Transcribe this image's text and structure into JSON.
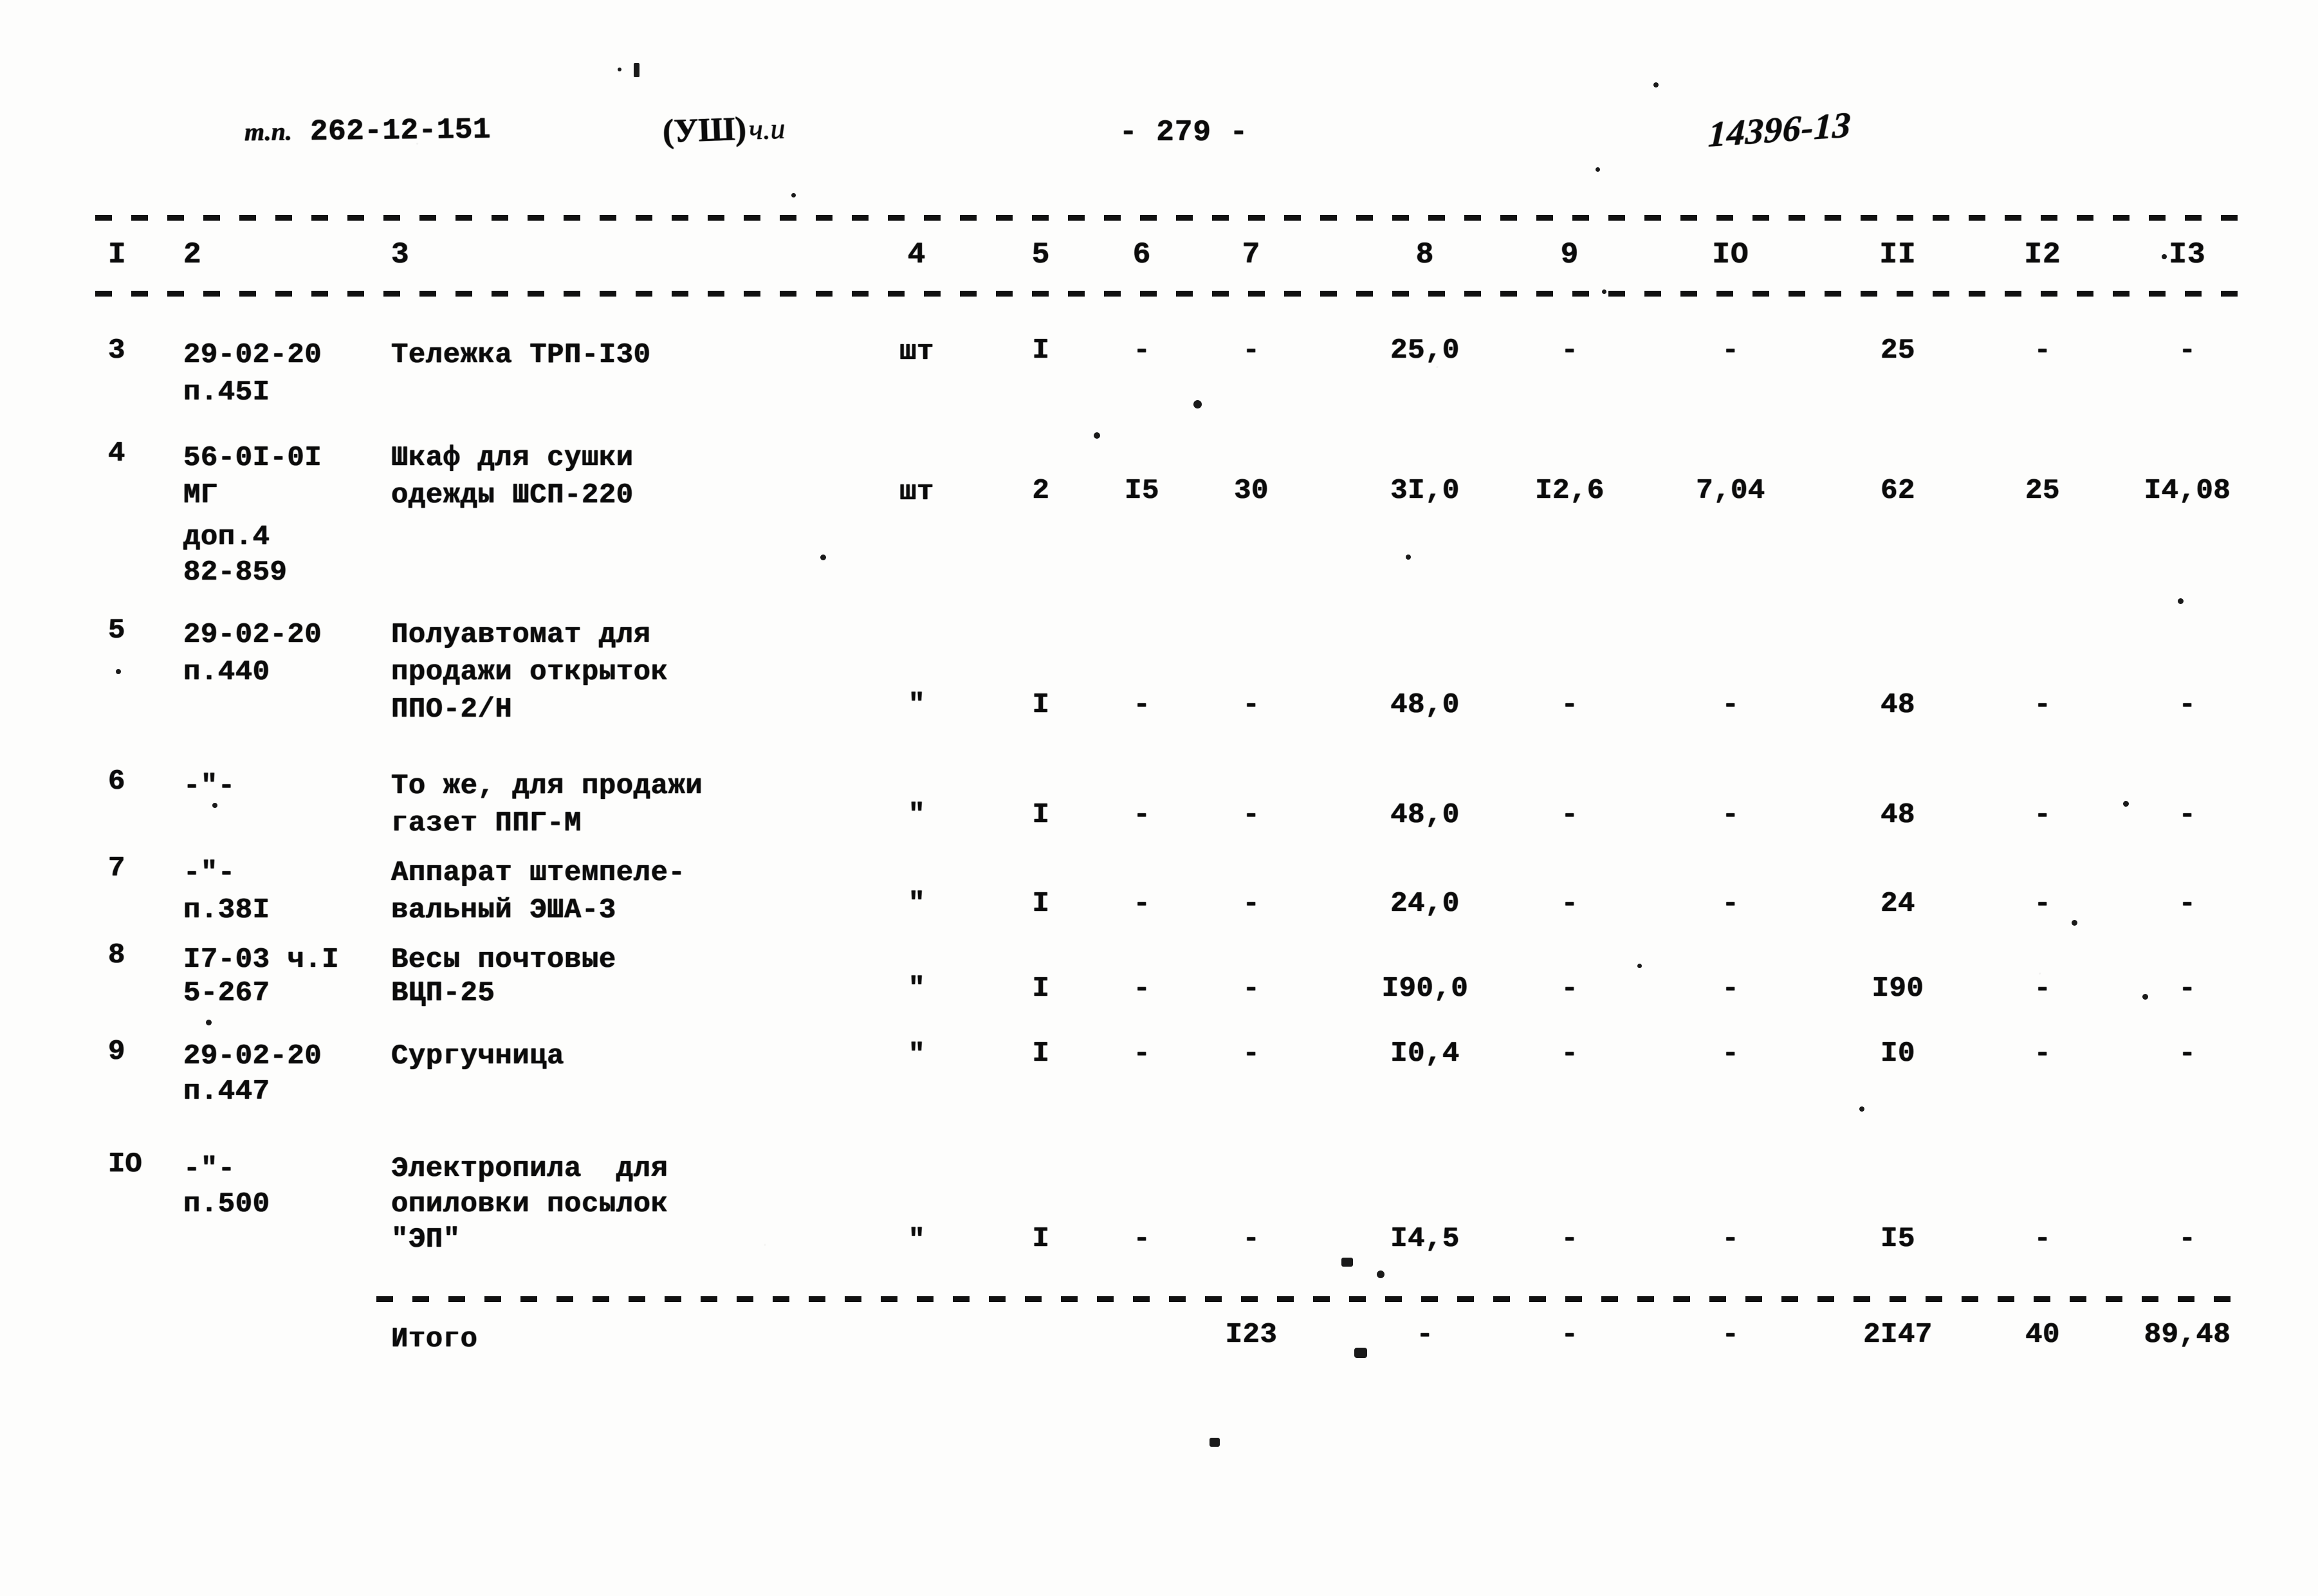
{
  "header": {
    "spec_prefix": "т.п.",
    "spec_code": "262-12-151",
    "hand_note": "(УШ)",
    "hand_scribble": "ч.и",
    "page_number": "- 279 -",
    "hand_archive_number": "14396-13"
  },
  "table": {
    "column_headers": [
      "I",
      "2",
      "3",
      "4",
      "5",
      "6",
      "7",
      "8",
      "9",
      "IO",
      "II",
      "I2",
      "I3"
    ],
    "rows": [
      {
        "index": "3",
        "code_lines": [
          "29-02-20",
          "п.45I"
        ],
        "name_lines": [
          "Тележка ТРП-I30"
        ],
        "c4": "шт",
        "c5": "I",
        "c6": "-",
        "c7": "-",
        "c8": "25,0",
        "c9": "-",
        "c10": "-",
        "c11": "25",
        "c12": "-",
        "c13": "-"
      },
      {
        "index": "4",
        "code_lines": [
          "56-0I-0I",
          "МГ",
          "доп.4",
          "82-859"
        ],
        "name_lines": [
          "Шкаф для сушки",
          "одежды ШСП-220"
        ],
        "c4": "шт",
        "c5": "2",
        "c6": "I5",
        "c7": "30",
        "c8": "3I,0",
        "c9": "I2,6",
        "c10": "7,04",
        "c11": "62",
        "c12": "25",
        "c13": "I4,08"
      },
      {
        "index": "5",
        "code_lines": [
          "29-02-20",
          "п.440"
        ],
        "name_lines": [
          "Полуавтомат для",
          "продажи открыток",
          "ППО-2/Н"
        ],
        "c4": "\"",
        "c5": "I",
        "c6": "-",
        "c7": "-",
        "c8": "48,0",
        "c9": "-",
        "c10": "-",
        "c11": "48",
        "c12": "-",
        "c13": "-"
      },
      {
        "index": "6",
        "code_lines": [
          "-\"-"
        ],
        "name_lines": [
          "То же, для продажи",
          "газет ППГ-М"
        ],
        "c4": "\"",
        "c5": "I",
        "c6": "-",
        "c7": "-",
        "c8": "48,0",
        "c9": "-",
        "c10": "-",
        "c11": "48",
        "c12": "-",
        "c13": "-"
      },
      {
        "index": "7",
        "code_lines": [
          "-\"-",
          "п.38I"
        ],
        "name_lines": [
          "Аппарат штемпеле-",
          "вальный ЭША-3"
        ],
        "c4": "\"",
        "c5": "I",
        "c6": "-",
        "c7": "-",
        "c8": "24,0",
        "c9": "-",
        "c10": "-",
        "c11": "24",
        "c12": "-",
        "c13": "-"
      },
      {
        "index": "8",
        "code_lines": [
          "I7-03 ч.I",
          "5-267"
        ],
        "name_lines": [
          "Весы почтовые",
          "ВЦП-25"
        ],
        "c4": "\"",
        "c5": "I",
        "c6": "-",
        "c7": "-",
        "c8": "I90,0",
        "c9": "-",
        "c10": "-",
        "c11": "I90",
        "c12": "-",
        "c13": "-"
      },
      {
        "index": "9",
        "code_lines": [
          "29-02-20",
          "п.447"
        ],
        "name_lines": [
          "Сургучница"
        ],
        "c4": "\"",
        "c5": "I",
        "c6": "-",
        "c7": "-",
        "c8": "I0,4",
        "c9": "-",
        "c10": "-",
        "c11": "I0",
        "c12": "-",
        "c13": "-"
      },
      {
        "index": "IO",
        "code_lines": [
          "-\"-",
          "п.500"
        ],
        "name_lines": [
          "Электропила  для",
          "опиловки посылок",
          "\"ЭП\""
        ],
        "c4": "\"",
        "c5": "I",
        "c6": "-",
        "c7": "-",
        "c8": "I4,5",
        "c9": "-",
        "c10": "-",
        "c11": "I5",
        "c12": "-",
        "c13": "-"
      }
    ],
    "total_row": {
      "label": "Итого",
      "c7": "I23",
      "c8": "-",
      "c9": "-",
      "c10": "-",
      "c11": "2I47",
      "c12": "40",
      "c13": "89,48"
    }
  }
}
